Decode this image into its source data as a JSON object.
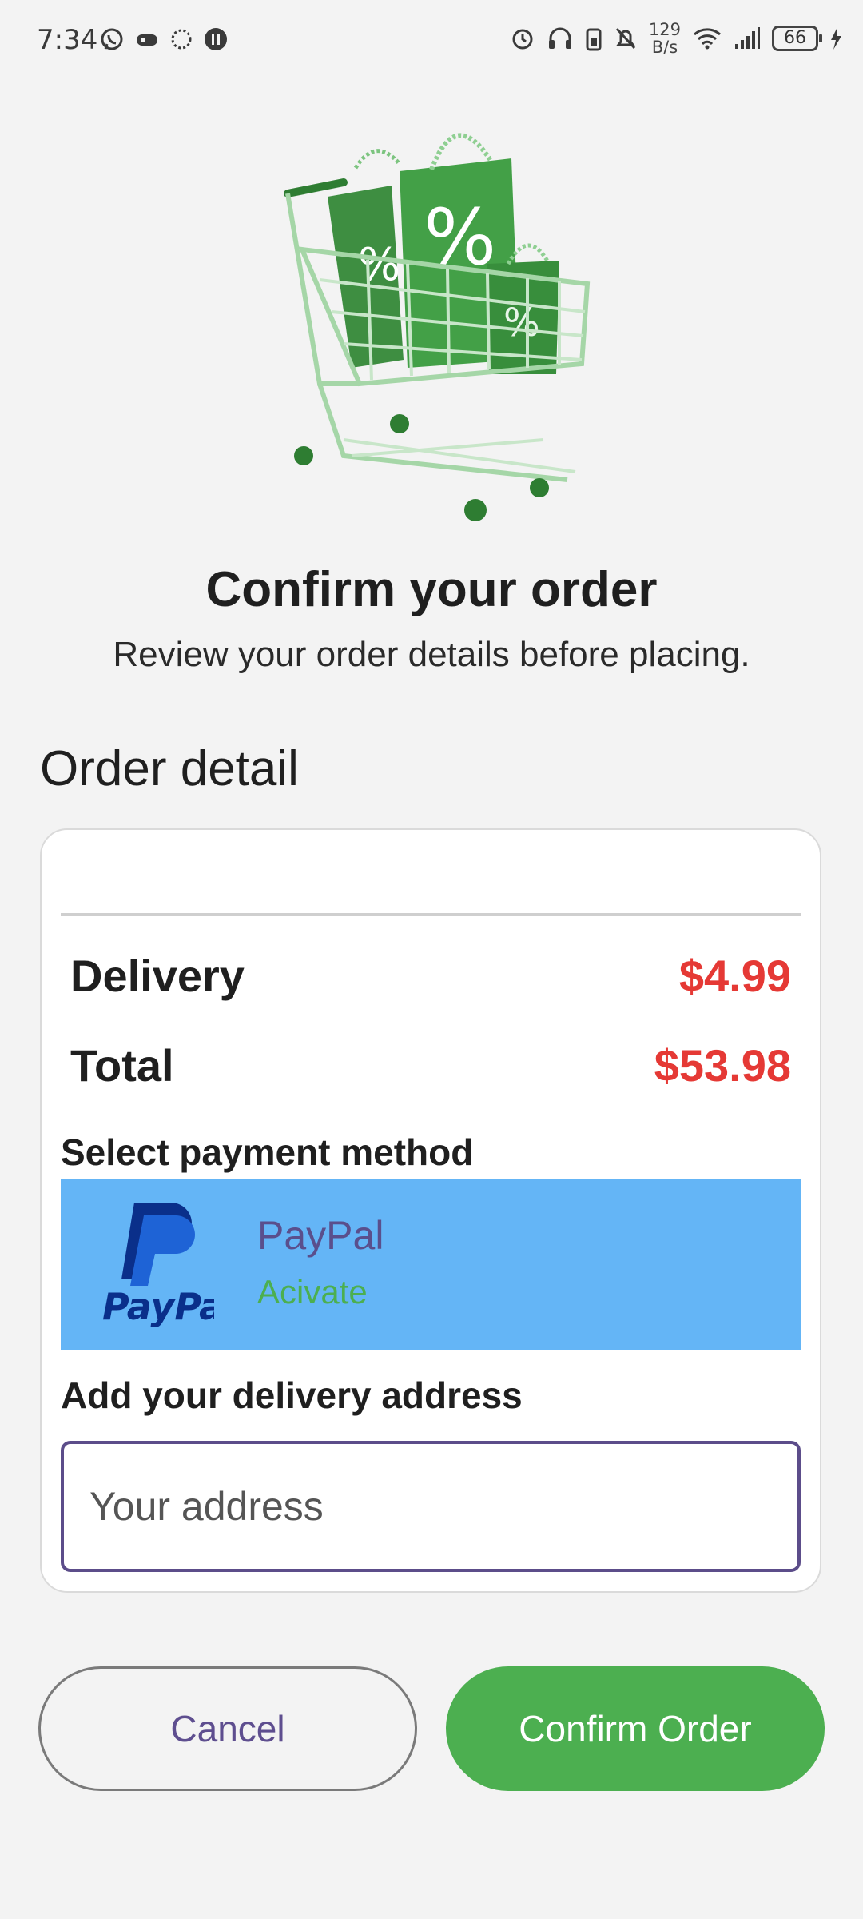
{
  "status_bar": {
    "time": "7:34",
    "net_speed_value": "129",
    "net_speed_unit": "B/s",
    "battery": "66"
  },
  "header": {
    "title": "Confirm your order",
    "subtitle": "Review your order details before placing."
  },
  "order": {
    "section_title": "Order detail",
    "delivery_label": "Delivery",
    "delivery_value": "$4.99",
    "total_label": "Total",
    "total_value": "$53.98"
  },
  "payment": {
    "label": "Select payment method",
    "option_name": "PayPal",
    "option_status": "Acivate"
  },
  "address": {
    "label": "Add your delivery address",
    "placeholder": "Your address",
    "value": ""
  },
  "actions": {
    "cancel_label": "Cancel",
    "confirm_label": "Confirm Order"
  },
  "colors": {
    "accent_green": "#4caf50",
    "price_red": "#e53935",
    "payment_highlight": "#64b5f6",
    "purple": "#5e4e8f"
  }
}
